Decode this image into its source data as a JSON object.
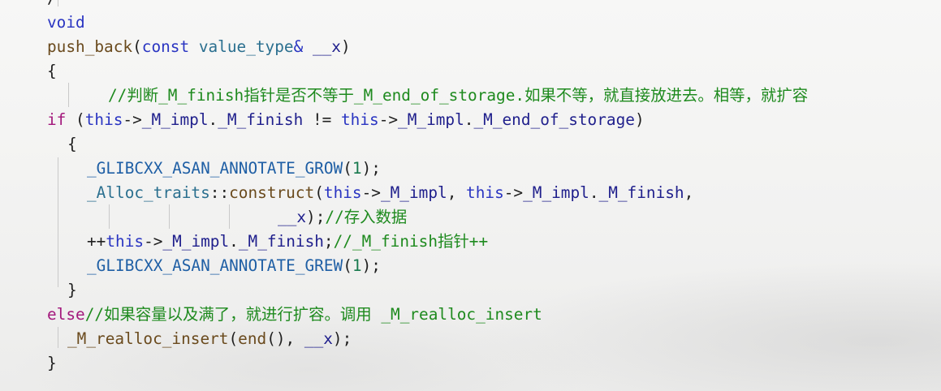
{
  "code": {
    "lines": [
      {
        "segments": [
          {
            "text": "/",
            "kind": "plain"
          }
        ]
      },
      {
        "segments": [
          {
            "text": "void",
            "kind": "kw"
          }
        ]
      },
      {
        "segments": [
          {
            "text": "push_back",
            "kind": "fn"
          },
          {
            "text": "(",
            "kind": "plain"
          },
          {
            "text": "const",
            "kind": "kw"
          },
          {
            "text": " ",
            "kind": "plain"
          },
          {
            "text": "value_type",
            "kind": "type"
          },
          {
            "text": "& ",
            "kind": "kw"
          },
          {
            "text": "__x",
            "kind": "mem"
          },
          {
            "text": ")",
            "kind": "plain"
          }
        ]
      },
      {
        "segments": [
          {
            "text": "{",
            "kind": "plain"
          }
        ]
      },
      {
        "segments": [
          {
            "text": "//判断_M_finish指针是否不等于_M_end_of_storage.如果不等，就直接放进去。相等，就扩容",
            "kind": "cm"
          }
        ]
      },
      {
        "segments": [
          {
            "text": "if",
            "kind": "ctrl"
          },
          {
            "text": " (",
            "kind": "plain"
          },
          {
            "text": "this",
            "kind": "kw"
          },
          {
            "text": "->",
            "kind": "plain"
          },
          {
            "text": "_M_impl",
            "kind": "mem"
          },
          {
            "text": ".",
            "kind": "plain"
          },
          {
            "text": "_M_finish",
            "kind": "mem"
          },
          {
            "text": " != ",
            "kind": "plain"
          },
          {
            "text": "this",
            "kind": "kw"
          },
          {
            "text": "->",
            "kind": "plain"
          },
          {
            "text": "_M_impl",
            "kind": "mem"
          },
          {
            "text": ".",
            "kind": "plain"
          },
          {
            "text": "_M_end_of_storage",
            "kind": "mem"
          },
          {
            "text": ")",
            "kind": "plain"
          }
        ]
      },
      {
        "segments": [
          {
            "text": "{",
            "kind": "plain"
          }
        ]
      },
      {
        "segments": [
          {
            "text": "_GLIBCXX_ASAN_ANNOTATE_GROW",
            "kind": "macro"
          },
          {
            "text": "(",
            "kind": "plain"
          },
          {
            "text": "1",
            "kind": "num"
          },
          {
            "text": ");",
            "kind": "plain"
          }
        ]
      },
      {
        "segments": [
          {
            "text": "_Alloc_traits",
            "kind": "type"
          },
          {
            "text": "::",
            "kind": "plain"
          },
          {
            "text": "construct",
            "kind": "fn"
          },
          {
            "text": "(",
            "kind": "plain"
          },
          {
            "text": "this",
            "kind": "kw"
          },
          {
            "text": "->",
            "kind": "plain"
          },
          {
            "text": "_M_impl",
            "kind": "mem"
          },
          {
            "text": ", ",
            "kind": "plain"
          },
          {
            "text": "this",
            "kind": "kw"
          },
          {
            "text": "->",
            "kind": "plain"
          },
          {
            "text": "_M_impl",
            "kind": "mem"
          },
          {
            "text": ".",
            "kind": "plain"
          },
          {
            "text": "_M_finish",
            "kind": "mem"
          },
          {
            "text": ",",
            "kind": "plain"
          }
        ]
      },
      {
        "segments": [
          {
            "text": "__x",
            "kind": "mem"
          },
          {
            "text": ");",
            "kind": "plain"
          },
          {
            "text": "//存入数据",
            "kind": "cm"
          }
        ]
      },
      {
        "segments": [
          {
            "text": "++",
            "kind": "plain"
          },
          {
            "text": "this",
            "kind": "kw"
          },
          {
            "text": "->",
            "kind": "plain"
          },
          {
            "text": "_M_impl",
            "kind": "mem"
          },
          {
            "text": ".",
            "kind": "plain"
          },
          {
            "text": "_M_finish",
            "kind": "mem"
          },
          {
            "text": ";",
            "kind": "plain"
          },
          {
            "text": "//_M_finish指针++",
            "kind": "cm"
          }
        ]
      },
      {
        "segments": [
          {
            "text": "_GLIBCXX_ASAN_ANNOTATE_GREW",
            "kind": "macro"
          },
          {
            "text": "(",
            "kind": "plain"
          },
          {
            "text": "1",
            "kind": "num"
          },
          {
            "text": ");",
            "kind": "plain"
          }
        ]
      },
      {
        "segments": [
          {
            "text": "}",
            "kind": "plain"
          }
        ]
      },
      {
        "segments": [
          {
            "text": "else",
            "kind": "ctrl"
          },
          {
            "text": "//如果容量以及满了，就进行扩容。调用 _M_realloc_insert",
            "kind": "cm"
          }
        ]
      },
      {
        "segments": [
          {
            "text": "_M_realloc_insert",
            "kind": "fn"
          },
          {
            "text": "(",
            "kind": "plain"
          },
          {
            "text": "end",
            "kind": "fn"
          },
          {
            "text": "(), ",
            "kind": "plain"
          },
          {
            "text": "__x",
            "kind": "mem"
          },
          {
            "text": ");",
            "kind": "plain"
          }
        ]
      },
      {
        "segments": [
          {
            "text": "}",
            "kind": "plain"
          }
        ]
      }
    ]
  }
}
